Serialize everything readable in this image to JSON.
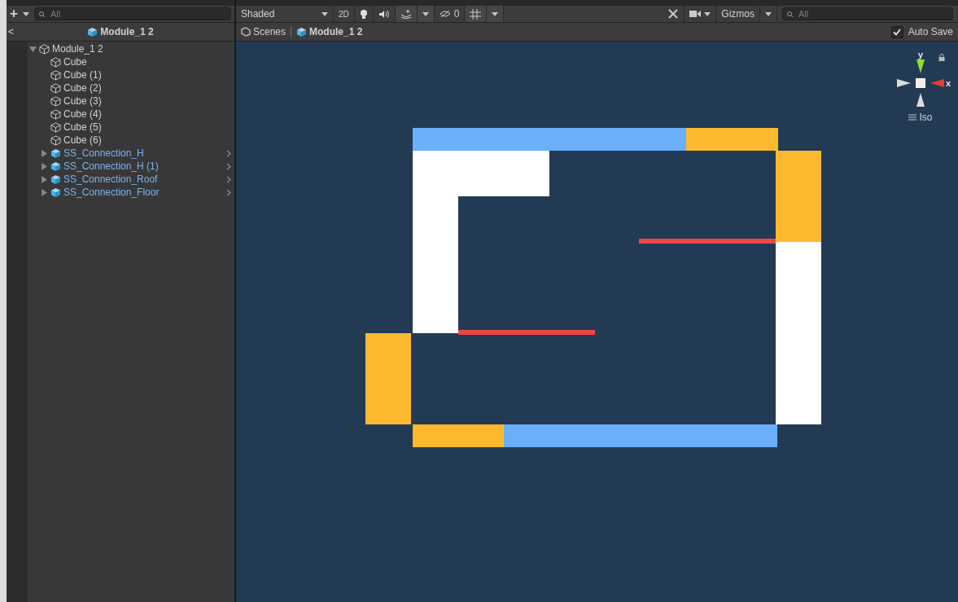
{
  "hierarchy": {
    "add_label": "+",
    "search": {
      "placeholder": "All"
    },
    "header": {
      "back": "<",
      "title": "Module_1 2"
    },
    "tree": [
      {
        "label": "Module_1 2",
        "kind": "object",
        "expanded": true,
        "children": [
          {
            "label": "Cube",
            "kind": "object"
          },
          {
            "label": "Cube (1)",
            "kind": "object"
          },
          {
            "label": "Cube (2)",
            "kind": "object"
          },
          {
            "label": "Cube (3)",
            "kind": "object"
          },
          {
            "label": "Cube (4)",
            "kind": "object"
          },
          {
            "label": "Cube (5)",
            "kind": "object"
          },
          {
            "label": "Cube (6)",
            "kind": "object"
          },
          {
            "label": "SS_Connection_H",
            "kind": "prefab",
            "expanded": false
          },
          {
            "label": "SS_Connection_H (1)",
            "kind": "prefab",
            "expanded": false
          },
          {
            "label": "SS_Connection_Roof",
            "kind": "prefab",
            "expanded": false
          },
          {
            "label": "SS_Connection_Floor",
            "kind": "prefab",
            "expanded": false
          }
        ]
      }
    ]
  },
  "scene": {
    "toolbar": {
      "shading": "Shaded",
      "mode_2d": "2D",
      "hidden_count": "0",
      "gizmos": "Gizmos",
      "search": {
        "placeholder": "All"
      }
    },
    "breadcrumb": [
      {
        "label": "Scenes",
        "kind": "scenes"
      },
      {
        "label": "Module_1 2",
        "kind": "prefab"
      }
    ],
    "auto_save": {
      "label": "Auto Save",
      "checked": true
    },
    "gizmo": {
      "y": "y",
      "x": "x",
      "projection": "Iso"
    }
  }
}
